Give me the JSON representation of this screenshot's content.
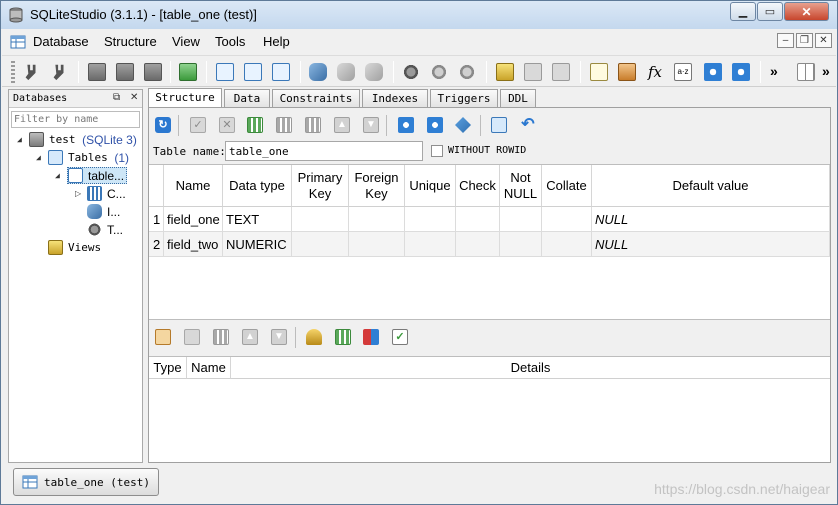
{
  "window": {
    "title": "SQLiteStudio (3.1.1) - [table_one (test)]"
  },
  "menu": [
    "Database",
    "Structure",
    "View",
    "Tools",
    "Help"
  ],
  "dock": {
    "title": "Databases",
    "filter_placeholder": "Filter by name"
  },
  "tree": {
    "db_name": "test",
    "db_version": "(SQLite 3)",
    "tables_label": "Tables",
    "tables_count": "(1)",
    "table_name": "table...",
    "children": [
      "C...",
      "I...",
      "T..."
    ],
    "views_label": "Views"
  },
  "tabs": [
    "Structure",
    "Data",
    "Constraints",
    "Indexes",
    "Triggers",
    "DDL"
  ],
  "structure": {
    "table_name_label": "Table name:",
    "table_name_value": "table_one",
    "without_rowid_label": "WITHOUT ROWID",
    "columns": {
      "headers": [
        "Name",
        "Data type",
        "Primary\nKey",
        "Foreign\nKey",
        "Unique",
        "Check",
        "Not\nNULL",
        "Collate",
        "Default value"
      ],
      "rows": [
        {
          "num": "1",
          "name": "field_one",
          "type": "TEXT",
          "default": "NULL"
        },
        {
          "num": "2",
          "name": "field_two",
          "type": "NUMERIC",
          "default": "NULL"
        }
      ]
    },
    "constraints": {
      "headers": [
        "Type",
        "Name",
        "Details"
      ]
    }
  },
  "taskbar": {
    "item_label": "table_one (test)"
  },
  "watermark": "https://blog.csdn.net/haigear",
  "colors": {
    "accent": "#3a6ea5",
    "titlebar": "#c4d8ee",
    "close": "#c7462d"
  }
}
